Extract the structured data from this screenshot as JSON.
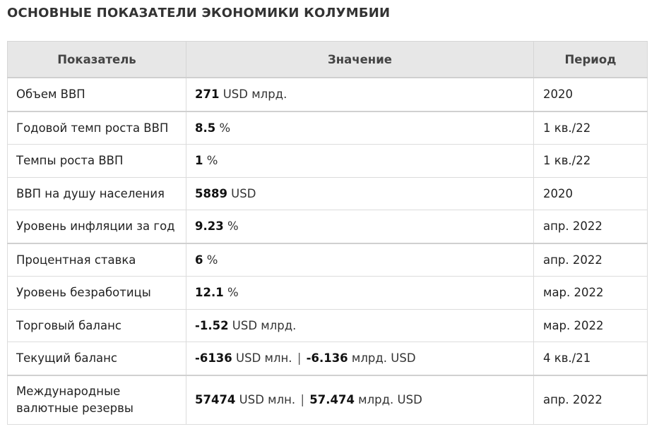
{
  "title": "ОСНОВНЫЕ ПОКАЗАТЕЛИ ЭКОНОМИКИ КОЛУМБИИ",
  "table": {
    "headers": [
      "Показатель",
      "Значение",
      "Период"
    ],
    "rows": [
      {
        "indicator": "Объем ВВП",
        "value1": "271",
        "unit1": " USD млрд.",
        "period": "2020"
      },
      {
        "indicator": "Годовой темп роста ВВП",
        "value1": "8.5",
        "unit1": " %",
        "period": "1 кв./22"
      },
      {
        "indicator": "Темпы роста ВВП",
        "value1": "1",
        "unit1": " %",
        "period": "1 кв./22"
      },
      {
        "indicator": "ВВП на душу населения",
        "value1": "5889",
        "unit1": " USD",
        "period": "2020"
      },
      {
        "indicator": "Уровень инфляции за год",
        "value1": "9.23",
        "unit1": " %",
        "period": "апр. 2022"
      },
      {
        "indicator": "Процентная ставка",
        "value1": "6",
        "unit1": " %",
        "period": "апр. 2022"
      },
      {
        "indicator": "Уровень безработицы",
        "value1": "12.1",
        "unit1": " %",
        "period": "мар. 2022"
      },
      {
        "indicator": "Торговый баланс",
        "value1": "-1.52",
        "unit1": " USD млрд.",
        "period": "мар. 2022"
      },
      {
        "indicator": "Текущий баланс",
        "value1": "-6136",
        "unit1": " USD млн.",
        "separator": "|",
        "value2": "-6.136",
        "unit2": " млрд. USD",
        "period": "4 кв./21"
      },
      {
        "indicator_line1": "Международные",
        "indicator_line2": "валютные резервы",
        "value1": "57474",
        "unit1": " USD млн.",
        "separator": "|",
        "value2": "57.474",
        "unit2": " млрд. USD",
        "period": "апр. 2022"
      }
    ]
  }
}
